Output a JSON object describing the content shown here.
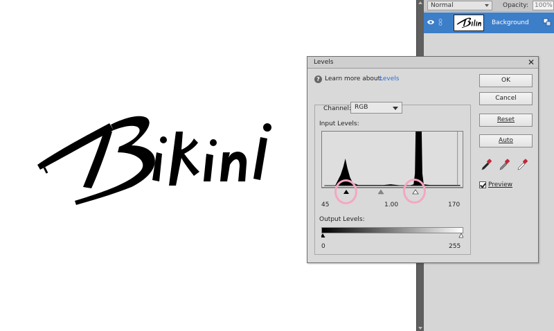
{
  "canvas": {
    "artwork_text": "Bikini"
  },
  "layers_panel": {
    "blend_mode": "Normal",
    "opacity_label": "Opacity:",
    "opacity_value": "100%",
    "layer": {
      "name": "Background",
      "thumbnail_text": "Bikini"
    }
  },
  "levels_dialog": {
    "title": "Levels",
    "close_glyph": "✕",
    "help": {
      "prefix": "Learn more about:",
      "link": "Levels"
    },
    "channel": {
      "label": "Channel:",
      "value": "RGB"
    },
    "input_levels": {
      "label": "Input Levels:",
      "black": "45",
      "gamma": "1.00",
      "white": "170"
    },
    "output_levels": {
      "label": "Output Levels:",
      "black": "0",
      "white": "255"
    },
    "buttons": {
      "ok": "OK",
      "cancel": "Cancel",
      "reset": "Reset",
      "auto": "Auto"
    },
    "preview": {
      "label": "Preview",
      "checked": true
    },
    "eyedroppers": [
      "black-point-eyedropper",
      "gray-point-eyedropper",
      "white-point-eyedropper"
    ]
  },
  "colors": {
    "selection": "#3d7ec9",
    "link": "#2e6fd0",
    "annotation": "#f4a6c4"
  }
}
